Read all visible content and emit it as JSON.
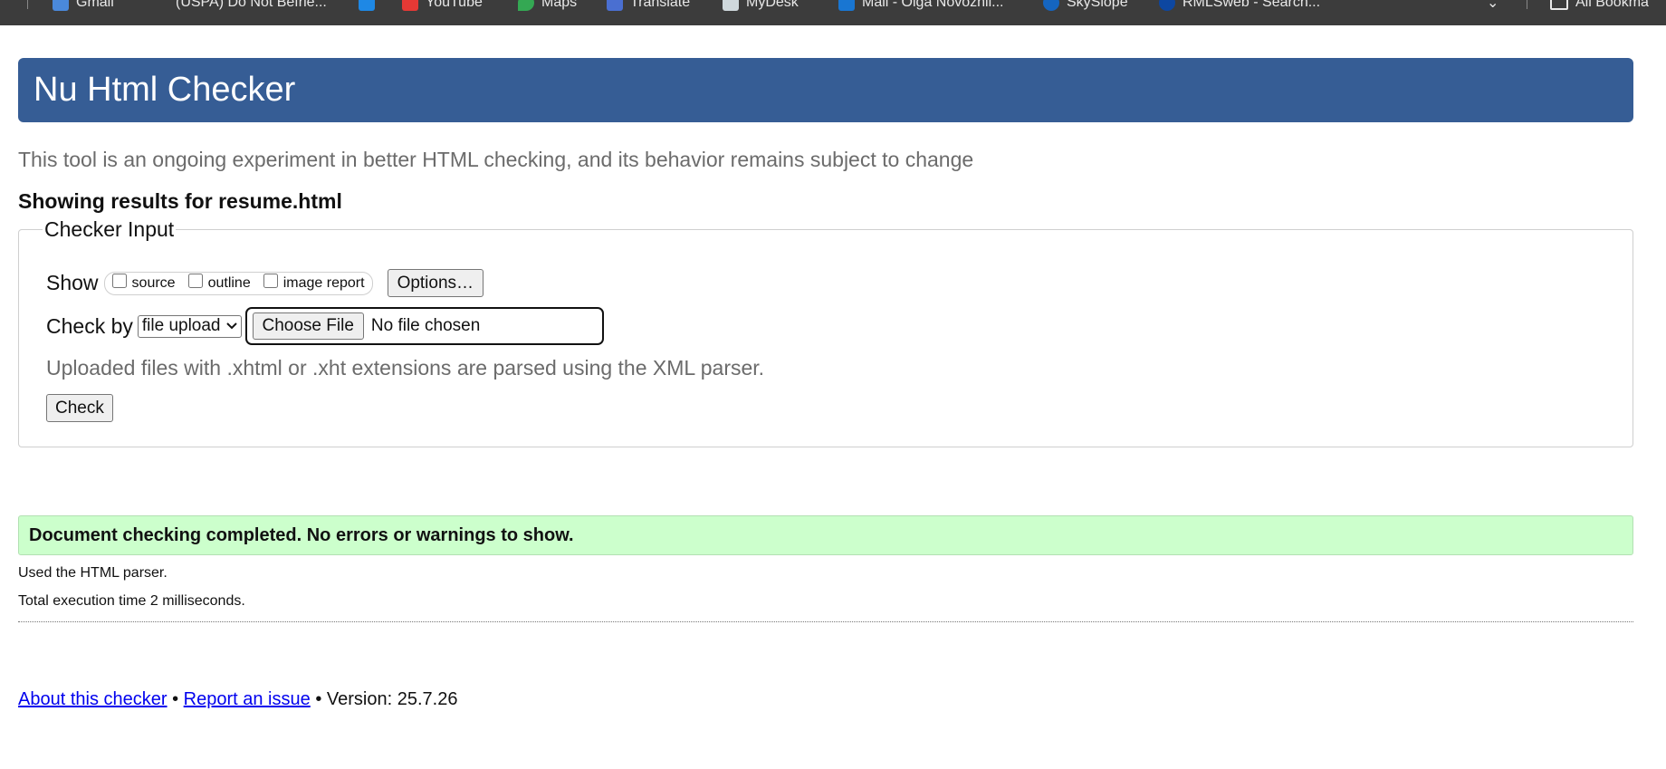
{
  "browser": {
    "bookmarks": [
      {
        "label": "Gmail",
        "icon": "gmail-icon",
        "color": "#4a89dc"
      },
      {
        "label": "(USPA) Do Not Befrie...",
        "icon": "page-icon",
        "color": "#3c3c3c"
      },
      {
        "label": "",
        "icon": "arrow-icon",
        "color": "#1e88e5"
      },
      {
        "label": "YouTube",
        "icon": "youtube-icon",
        "color": "#e53935"
      },
      {
        "label": "Maps",
        "icon": "maps-icon",
        "color": "#34a853"
      },
      {
        "label": "Translate",
        "icon": "translate-icon",
        "color": "#4a6fd1"
      },
      {
        "label": "MyDesk",
        "icon": "mydesk-icon",
        "color": "#cfd8dc"
      },
      {
        "label": "Mail - Olga Novozhil...",
        "icon": "mail-icon",
        "color": "#1976d2"
      },
      {
        "label": "SkySlope",
        "icon": "skyslope-icon",
        "color": "#1565c0"
      },
      {
        "label": "RMLSweb - Search...",
        "icon": "rmls-icon",
        "color": "#0d47a1"
      }
    ],
    "all_bookmarks_label": "All Bookma"
  },
  "header": {
    "title": "Nu Html Checker",
    "color": "#365d95"
  },
  "tagline": "This tool is an ongoing experiment in better HTML checking, and its behavior remains subject to change",
  "results_for": "Showing results for resume.html",
  "checker_input": {
    "legend": "Checker Input",
    "show_label": "Show",
    "show_options": [
      {
        "label": "source",
        "checked": false
      },
      {
        "label": "outline",
        "checked": false
      },
      {
        "label": "image report",
        "checked": false
      }
    ],
    "options_button": "Options…",
    "check_by_label": "Check by",
    "check_by_value": "file upload",
    "choose_file_button": "Choose File",
    "file_status": "No file chosen",
    "hint": "Uploaded files with .xhtml or .xht extensions are parsed using the XML parser.",
    "check_button": "Check"
  },
  "result": {
    "message": "Document checking completed. No errors or warnings to show.",
    "color": "#ccffcc",
    "parser_info": "Used the HTML parser.",
    "execution_time": "Total execution time 2 milliseconds."
  },
  "footer": {
    "about_link": "About this checker",
    "separator": "•",
    "report_link": "Report an issue",
    "version": "Version: 25.7.26"
  }
}
